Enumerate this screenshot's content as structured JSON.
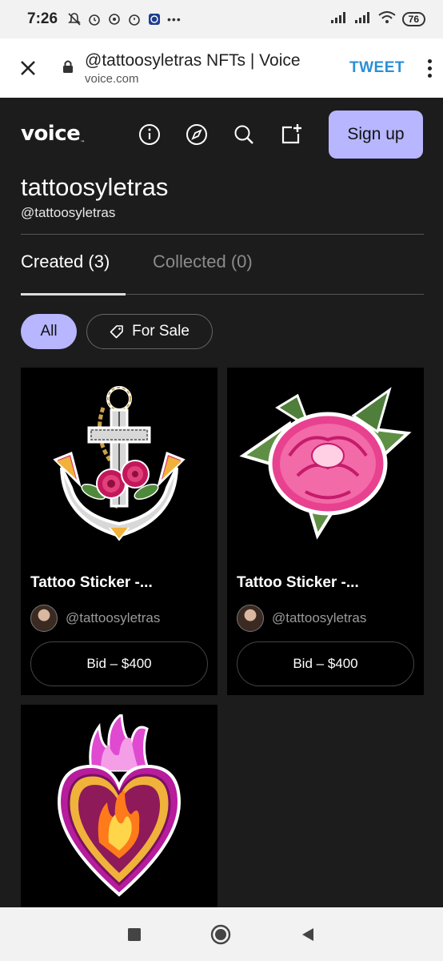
{
  "status_bar": {
    "time": "7:26",
    "battery": "76",
    "more": "•••"
  },
  "browser": {
    "page_title": "@tattoosyletras NFTs | Voice",
    "domain": "voice.com",
    "tweet_label": "TWEET"
  },
  "site": {
    "logo": "voice",
    "logo_tm": "™",
    "signup_label": "Sign up",
    "nav_icons": [
      "info-icon",
      "compass-icon",
      "search-icon",
      "create-icon"
    ]
  },
  "profile": {
    "name": "tattoosyletras",
    "handle": "@tattoosyletras"
  },
  "tabs": [
    {
      "label": "Created (3)",
      "active": true
    },
    {
      "label": "Collected (0)",
      "active": false
    }
  ],
  "filters": {
    "all_label": "All",
    "sale_label": "For Sale"
  },
  "cards": [
    {
      "title": "Tattoo Sticker -...",
      "owner": "@tattoosyletras",
      "bid": "Bid – $400",
      "art": "anchor-with-roses"
    },
    {
      "title": "Tattoo Sticker -...",
      "owner": "@tattoosyletras",
      "bid": "Bid – $400",
      "art": "pink-peony"
    },
    {
      "art": "sacred-heart-flames"
    }
  ],
  "colors": {
    "accent": "#b7b6ff",
    "background": "#1c1c1c",
    "card": "#000000",
    "tweet": "#2a8fd6"
  }
}
